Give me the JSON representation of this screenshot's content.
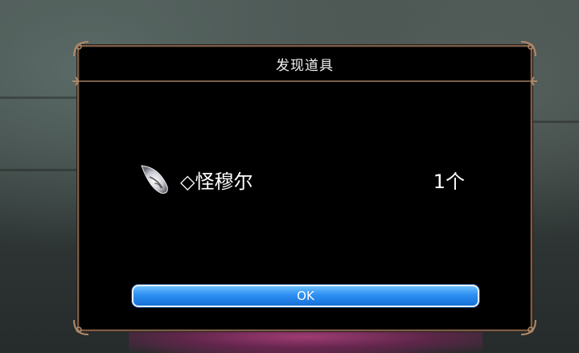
{
  "dialog": {
    "title": "发现道具",
    "item": {
      "icon": "feather-crystal-icon",
      "name": "◇怪穆尔",
      "quantity": "1个"
    },
    "ok_label": "OK"
  },
  "colors": {
    "frame": "#7a5e4a",
    "button": "#2d8ff2",
    "panel": "#000000"
  }
}
